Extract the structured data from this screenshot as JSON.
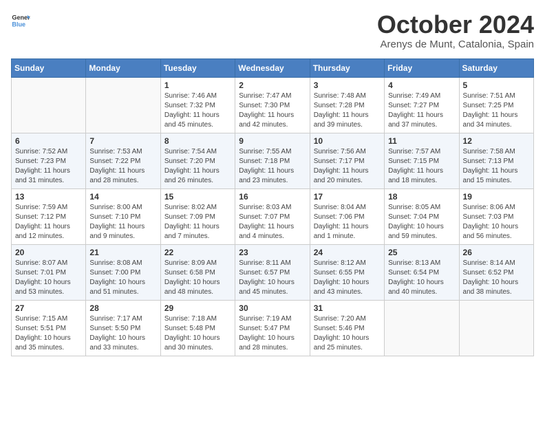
{
  "header": {
    "logo_general": "General",
    "logo_blue": "Blue",
    "month_title": "October 2024",
    "location": "Arenys de Munt, Catalonia, Spain"
  },
  "days_of_week": [
    "Sunday",
    "Monday",
    "Tuesday",
    "Wednesday",
    "Thursday",
    "Friday",
    "Saturday"
  ],
  "weeks": [
    [
      {
        "day": "",
        "empty": true
      },
      {
        "day": "",
        "empty": true
      },
      {
        "day": "1",
        "sunrise": "Sunrise: 7:46 AM",
        "sunset": "Sunset: 7:32 PM",
        "daylight": "Daylight: 11 hours and 45 minutes."
      },
      {
        "day": "2",
        "sunrise": "Sunrise: 7:47 AM",
        "sunset": "Sunset: 7:30 PM",
        "daylight": "Daylight: 11 hours and 42 minutes."
      },
      {
        "day": "3",
        "sunrise": "Sunrise: 7:48 AM",
        "sunset": "Sunset: 7:28 PM",
        "daylight": "Daylight: 11 hours and 39 minutes."
      },
      {
        "day": "4",
        "sunrise": "Sunrise: 7:49 AM",
        "sunset": "Sunset: 7:27 PM",
        "daylight": "Daylight: 11 hours and 37 minutes."
      },
      {
        "day": "5",
        "sunrise": "Sunrise: 7:51 AM",
        "sunset": "Sunset: 7:25 PM",
        "daylight": "Daylight: 11 hours and 34 minutes."
      }
    ],
    [
      {
        "day": "6",
        "sunrise": "Sunrise: 7:52 AM",
        "sunset": "Sunset: 7:23 PM",
        "daylight": "Daylight: 11 hours and 31 minutes."
      },
      {
        "day": "7",
        "sunrise": "Sunrise: 7:53 AM",
        "sunset": "Sunset: 7:22 PM",
        "daylight": "Daylight: 11 hours and 28 minutes."
      },
      {
        "day": "8",
        "sunrise": "Sunrise: 7:54 AM",
        "sunset": "Sunset: 7:20 PM",
        "daylight": "Daylight: 11 hours and 26 minutes."
      },
      {
        "day": "9",
        "sunrise": "Sunrise: 7:55 AM",
        "sunset": "Sunset: 7:18 PM",
        "daylight": "Daylight: 11 hours and 23 minutes."
      },
      {
        "day": "10",
        "sunrise": "Sunrise: 7:56 AM",
        "sunset": "Sunset: 7:17 PM",
        "daylight": "Daylight: 11 hours and 20 minutes."
      },
      {
        "day": "11",
        "sunrise": "Sunrise: 7:57 AM",
        "sunset": "Sunset: 7:15 PM",
        "daylight": "Daylight: 11 hours and 18 minutes."
      },
      {
        "day": "12",
        "sunrise": "Sunrise: 7:58 AM",
        "sunset": "Sunset: 7:13 PM",
        "daylight": "Daylight: 11 hours and 15 minutes."
      }
    ],
    [
      {
        "day": "13",
        "sunrise": "Sunrise: 7:59 AM",
        "sunset": "Sunset: 7:12 PM",
        "daylight": "Daylight: 11 hours and 12 minutes."
      },
      {
        "day": "14",
        "sunrise": "Sunrise: 8:00 AM",
        "sunset": "Sunset: 7:10 PM",
        "daylight": "Daylight: 11 hours and 9 minutes."
      },
      {
        "day": "15",
        "sunrise": "Sunrise: 8:02 AM",
        "sunset": "Sunset: 7:09 PM",
        "daylight": "Daylight: 11 hours and 7 minutes."
      },
      {
        "day": "16",
        "sunrise": "Sunrise: 8:03 AM",
        "sunset": "Sunset: 7:07 PM",
        "daylight": "Daylight: 11 hours and 4 minutes."
      },
      {
        "day": "17",
        "sunrise": "Sunrise: 8:04 AM",
        "sunset": "Sunset: 7:06 PM",
        "daylight": "Daylight: 11 hours and 1 minute."
      },
      {
        "day": "18",
        "sunrise": "Sunrise: 8:05 AM",
        "sunset": "Sunset: 7:04 PM",
        "daylight": "Daylight: 10 hours and 59 minutes."
      },
      {
        "day": "19",
        "sunrise": "Sunrise: 8:06 AM",
        "sunset": "Sunset: 7:03 PM",
        "daylight": "Daylight: 10 hours and 56 minutes."
      }
    ],
    [
      {
        "day": "20",
        "sunrise": "Sunrise: 8:07 AM",
        "sunset": "Sunset: 7:01 PM",
        "daylight": "Daylight: 10 hours and 53 minutes."
      },
      {
        "day": "21",
        "sunrise": "Sunrise: 8:08 AM",
        "sunset": "Sunset: 7:00 PM",
        "daylight": "Daylight: 10 hours and 51 minutes."
      },
      {
        "day": "22",
        "sunrise": "Sunrise: 8:09 AM",
        "sunset": "Sunset: 6:58 PM",
        "daylight": "Daylight: 10 hours and 48 minutes."
      },
      {
        "day": "23",
        "sunrise": "Sunrise: 8:11 AM",
        "sunset": "Sunset: 6:57 PM",
        "daylight": "Daylight: 10 hours and 45 minutes."
      },
      {
        "day": "24",
        "sunrise": "Sunrise: 8:12 AM",
        "sunset": "Sunset: 6:55 PM",
        "daylight": "Daylight: 10 hours and 43 minutes."
      },
      {
        "day": "25",
        "sunrise": "Sunrise: 8:13 AM",
        "sunset": "Sunset: 6:54 PM",
        "daylight": "Daylight: 10 hours and 40 minutes."
      },
      {
        "day": "26",
        "sunrise": "Sunrise: 8:14 AM",
        "sunset": "Sunset: 6:52 PM",
        "daylight": "Daylight: 10 hours and 38 minutes."
      }
    ],
    [
      {
        "day": "27",
        "sunrise": "Sunrise: 7:15 AM",
        "sunset": "Sunset: 5:51 PM",
        "daylight": "Daylight: 10 hours and 35 minutes."
      },
      {
        "day": "28",
        "sunrise": "Sunrise: 7:17 AM",
        "sunset": "Sunset: 5:50 PM",
        "daylight": "Daylight: 10 hours and 33 minutes."
      },
      {
        "day": "29",
        "sunrise": "Sunrise: 7:18 AM",
        "sunset": "Sunset: 5:48 PM",
        "daylight": "Daylight: 10 hours and 30 minutes."
      },
      {
        "day": "30",
        "sunrise": "Sunrise: 7:19 AM",
        "sunset": "Sunset: 5:47 PM",
        "daylight": "Daylight: 10 hours and 28 minutes."
      },
      {
        "day": "31",
        "sunrise": "Sunrise: 7:20 AM",
        "sunset": "Sunset: 5:46 PM",
        "daylight": "Daylight: 10 hours and 25 minutes."
      },
      {
        "day": "",
        "empty": true
      },
      {
        "day": "",
        "empty": true
      }
    ]
  ]
}
